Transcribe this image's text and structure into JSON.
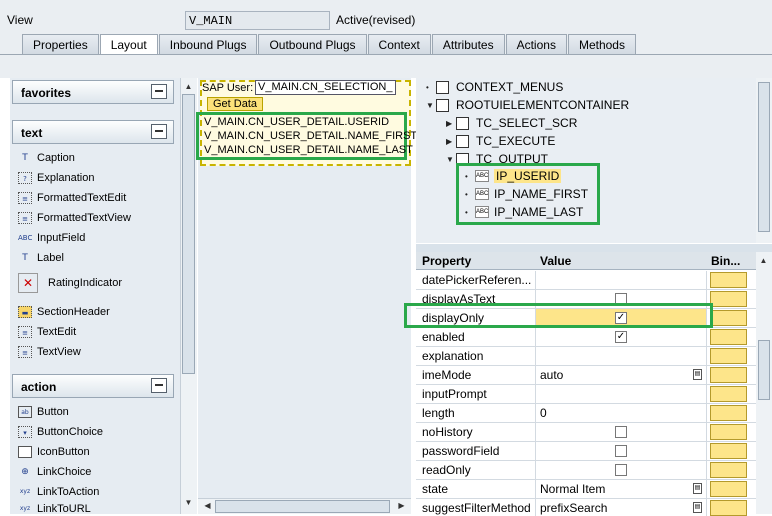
{
  "header": {
    "view_label": "View",
    "view_value": "V_MAIN",
    "status": "Active(revised)"
  },
  "tabs": [
    "Properties",
    "Layout",
    "Inbound Plugs",
    "Outbound Plugs",
    "Context",
    "Attributes",
    "Actions",
    "Methods"
  ],
  "active_tab": "Layout",
  "palette": {
    "favorites_title": "favorites",
    "text_title": "text",
    "text_items": [
      "Caption",
      "Explanation",
      "FormattedTextEdit",
      "FormattedTextView",
      "InputField",
      "Label",
      "RatingIndicator",
      "SectionHeader",
      "TextEdit",
      "TextView"
    ],
    "action_title": "action",
    "action_items": [
      "Button",
      "ButtonChoice",
      "IconButton",
      "LinkChoice",
      "LinkToAction",
      "LinkToURL"
    ]
  },
  "preview": {
    "sap_user_label": "SAP User:",
    "selection_field": "V_MAIN.CN_SELECTION_",
    "get_data_button": "Get Data",
    "details": [
      "V_MAIN.CN_USER_DETAIL.USERID",
      "V_MAIN.CN_USER_DETAIL.NAME_FIRST",
      "V_MAIN.CN_USER_DETAIL.NAME_LAST"
    ]
  },
  "tree": {
    "nodes": [
      "CONTEXT_MENUS",
      "ROOTUIELEMENTCONTAINER",
      "TC_SELECT_SCR",
      "TC_EXECUTE",
      "TC_OUTPUT"
    ],
    "outputs": [
      "IP_USERID",
      "IP_NAME_FIRST",
      "IP_NAME_LAST"
    ]
  },
  "properties": {
    "headers": [
      "Property",
      "Value",
      "Bin..."
    ],
    "rows": [
      {
        "name": "datePickerReferen...",
        "value": "",
        "checkbox": false,
        "checked": false
      },
      {
        "name": "displayAsText",
        "value": "",
        "checkbox": true,
        "checked": false
      },
      {
        "name": "displayOnly",
        "value": "",
        "checkbox": true,
        "checked": true
      },
      {
        "name": "enabled",
        "value": "",
        "checkbox": true,
        "checked": true
      },
      {
        "name": "explanation",
        "value": "",
        "checkbox": false,
        "checked": false
      },
      {
        "name": "imeMode",
        "value": "auto",
        "checkbox": false,
        "checked": false,
        "dropdown": true
      },
      {
        "name": "inputPrompt",
        "value": "",
        "checkbox": false,
        "checked": false
      },
      {
        "name": "length",
        "value": "0",
        "checkbox": false,
        "checked": false
      },
      {
        "name": "noHistory",
        "value": "",
        "checkbox": true,
        "checked": false
      },
      {
        "name": "passwordField",
        "value": "",
        "checkbox": true,
        "checked": false
      },
      {
        "name": "readOnly",
        "value": "",
        "checkbox": true,
        "checked": false
      },
      {
        "name": "state",
        "value": "Normal Item",
        "checkbox": false,
        "checked": false,
        "dropdown": true
      },
      {
        "name": "suggestFilterMethod",
        "value": "prefixSearch",
        "checkbox": false,
        "checked": false,
        "dropdown": true
      }
    ]
  },
  "colors": {
    "highlight": "#fde58a",
    "annotation": "#2aa84a"
  }
}
